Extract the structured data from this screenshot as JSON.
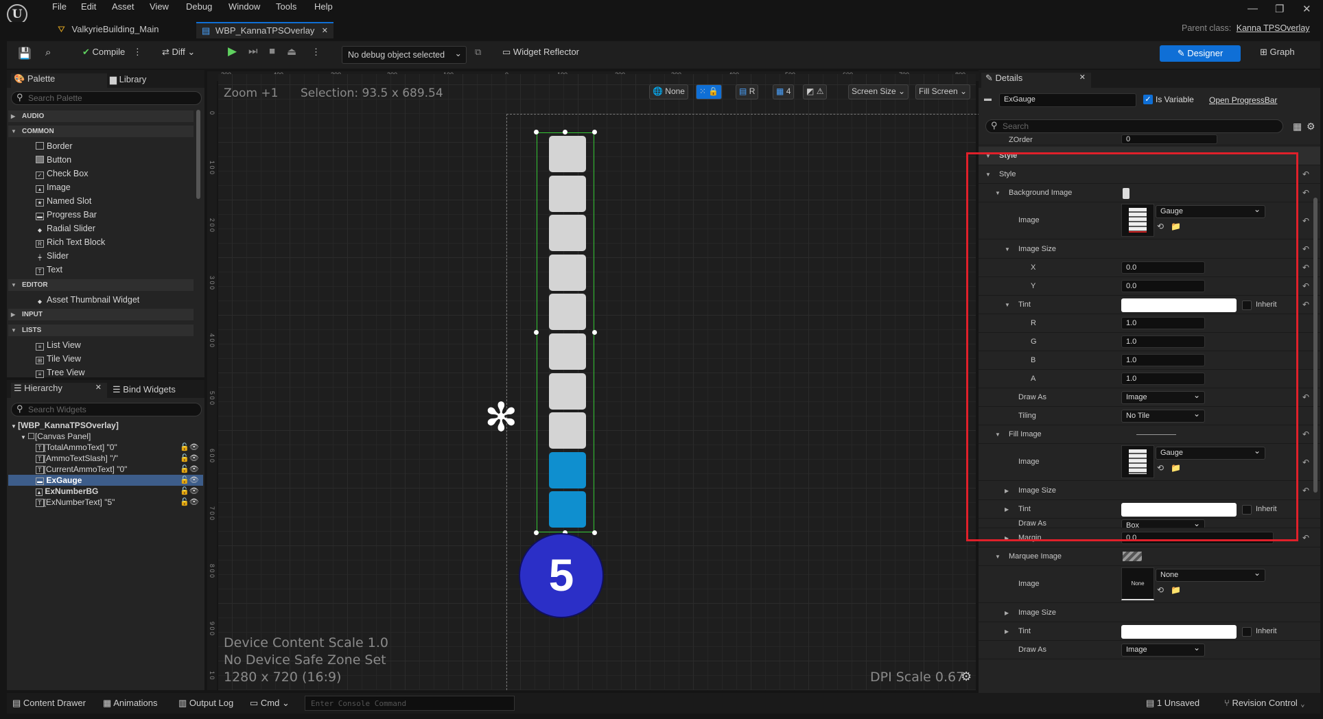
{
  "menu": [
    "File",
    "Edit",
    "Asset",
    "View",
    "Debug",
    "Window",
    "Tools",
    "Help"
  ],
  "tabs": [
    {
      "label": "ValkyrieBuilding_Main"
    },
    {
      "label": "WBP_KannaTPSOverlay"
    }
  ],
  "parent_class": {
    "label": "Parent class:",
    "value": "Kanna TPSOverlay"
  },
  "toolbar": {
    "compile": "Compile",
    "diff": "Diff",
    "debug_object": "No debug object selected",
    "widget_reflector": "Widget Reflector",
    "designer": "Designer",
    "graph": "Graph"
  },
  "palette": {
    "tab": "Palette",
    "library_tab": "Library",
    "search_placeholder": "Search Palette",
    "categories": {
      "audio": "AUDIO",
      "common": "COMMON",
      "editor": "EDITOR",
      "input": "INPUT",
      "lists": "LISTS"
    },
    "common_items": [
      "Border",
      "Button",
      "Check Box",
      "Image",
      "Named Slot",
      "Progress Bar",
      "Radial Slider",
      "Rich Text Block",
      "Slider",
      "Text"
    ],
    "editor_items": [
      "Asset Thumbnail Widget"
    ],
    "list_items": [
      "List View",
      "Tile View",
      "Tree View"
    ]
  },
  "hierarchy": {
    "tab": "Hierarchy",
    "bind_tab": "Bind Widgets",
    "search_placeholder": "Search Widgets",
    "items": [
      "[WBP_KannaTPSOverlay]",
      "[Canvas Panel]",
      "[TotalAmmoText] \"0\"",
      "[AmmoTextSlash] \"/\"",
      "[CurrentAmmoText] \"0\"",
      "ExGauge",
      "ExNumberBG",
      "[ExNumberText] \"5\""
    ]
  },
  "viewport": {
    "zoom": "Zoom +1",
    "selection": "Selection: 93.5 x 689.54",
    "none": "None",
    "r": "R",
    "grid_value": "4",
    "screen_size": "Screen Size",
    "fill_screen": "Fill Screen",
    "device_scale": "Device Content Scale 1.0",
    "safe_zone": "No Device Safe Zone Set",
    "resolution": "1280 x 720 (16:9)",
    "dpi_scale": "DPI Scale 0.67",
    "gauge_number": "5",
    "gauge_total_segments": 10,
    "gauge_filled_segments": 2,
    "ruler_top": [
      "300",
      "400",
      "300",
      "200",
      "100",
      "0",
      "100",
      "200",
      "300",
      "400",
      "500",
      "600",
      "700",
      "800"
    ],
    "ruler_left": [
      "0",
      "1 0 0",
      "2 0 0",
      "3 0 0",
      "4 0 0",
      "5 0 0",
      "6 0 0",
      "7 0 0",
      "8 0 0",
      "9 0 0",
      "1 0"
    ]
  },
  "details": {
    "tab": "Details",
    "widget_name": "ExGauge",
    "is_variable": "Is Variable",
    "open": "Open ProgressBar",
    "search_placeholder": "Search",
    "zorder_label": "ZOrder",
    "zorder_value": "0",
    "style_section": "Style",
    "style": "Style",
    "background_image": "Background Image",
    "image_label": "Image",
    "bg_image_asset": "Gauge",
    "image_size": "Image Size",
    "x_label": "X",
    "x_value": "0.0",
    "y_label": "Y",
    "y_value": "0.0",
    "tint": "Tint",
    "inherit": "Inherit",
    "r_label": "R",
    "r_value": "1.0",
    "g_label": "G",
    "g_value": "1.0",
    "b_label": "B",
    "b_value": "1.0",
    "a_label": "A",
    "a_value": "1.0",
    "draw_as": "Draw As",
    "draw_as_value": "Image",
    "tiling": "Tiling",
    "tiling_value": "No Tile",
    "fill_image": "Fill Image",
    "fill_image_asset": "Gauge",
    "fill_draw_as_value": "Box",
    "margin": "Margin",
    "margin_value": "0.0",
    "marquee_image": "Marquee Image",
    "marquee_asset": "None",
    "marquee_thumb": "None",
    "marquee_draw_as_value": "Image"
  },
  "status": {
    "content_drawer": "Content Drawer",
    "animations": "Animations",
    "output_log": "Output Log",
    "cmd": "Cmd",
    "console_placeholder": "Enter Console Command",
    "unsaved": "1 Unsaved",
    "revision": "Revision Control"
  },
  "colors": {
    "accent": "#0f6fd6",
    "gauge_fill": "#0f8fcf",
    "gauge_empty": "#d4d4d4",
    "badge": "#2b2fc7",
    "highlight_box": "#e0202a",
    "selection": "#35c935"
  }
}
